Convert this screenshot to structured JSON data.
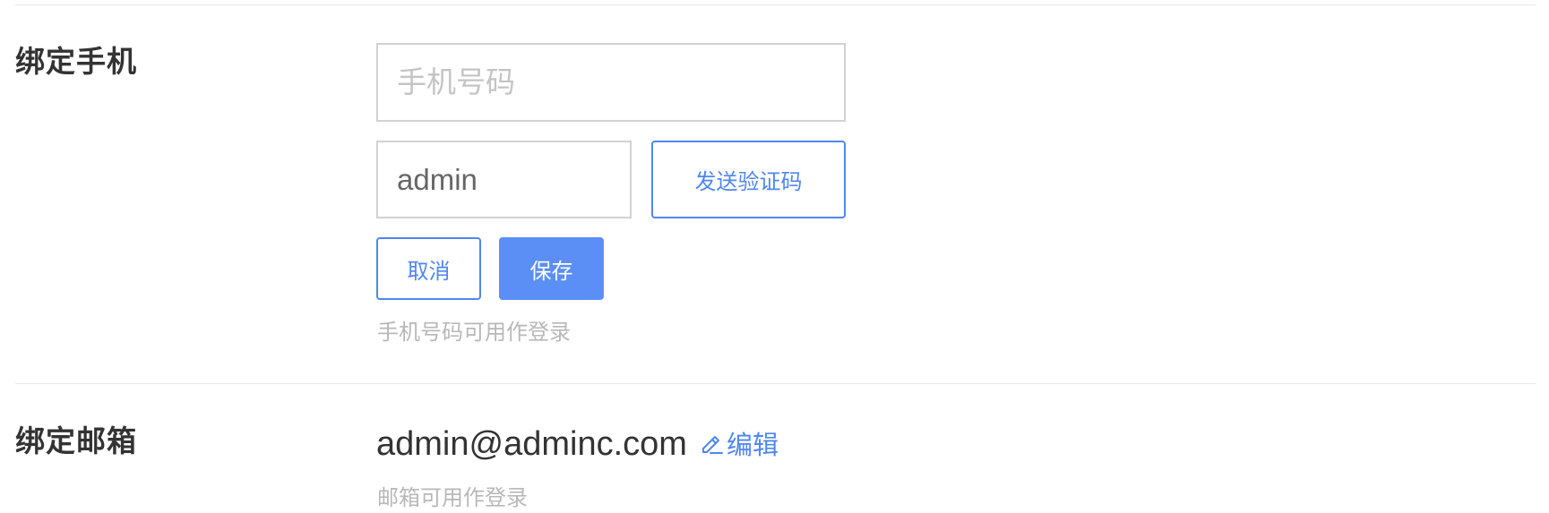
{
  "phone_section": {
    "title": "绑定手机",
    "phone_placeholder": "手机号码",
    "code_value": "admin",
    "send_code_label": "发送验证码",
    "cancel_label": "取消",
    "save_label": "保存",
    "hint": "手机号码可用作登录"
  },
  "email_section": {
    "title": "绑定邮箱",
    "email": "admin@adminc.com",
    "edit_label": "编辑",
    "edit_icon": "edit-pencil-icon",
    "hint": "邮箱可用作登录"
  },
  "colors": {
    "accent": "#4f87f0",
    "primary_button": "#5b8ff5",
    "hint_text": "#b8b8b8",
    "divider": "#e8e8e8"
  }
}
